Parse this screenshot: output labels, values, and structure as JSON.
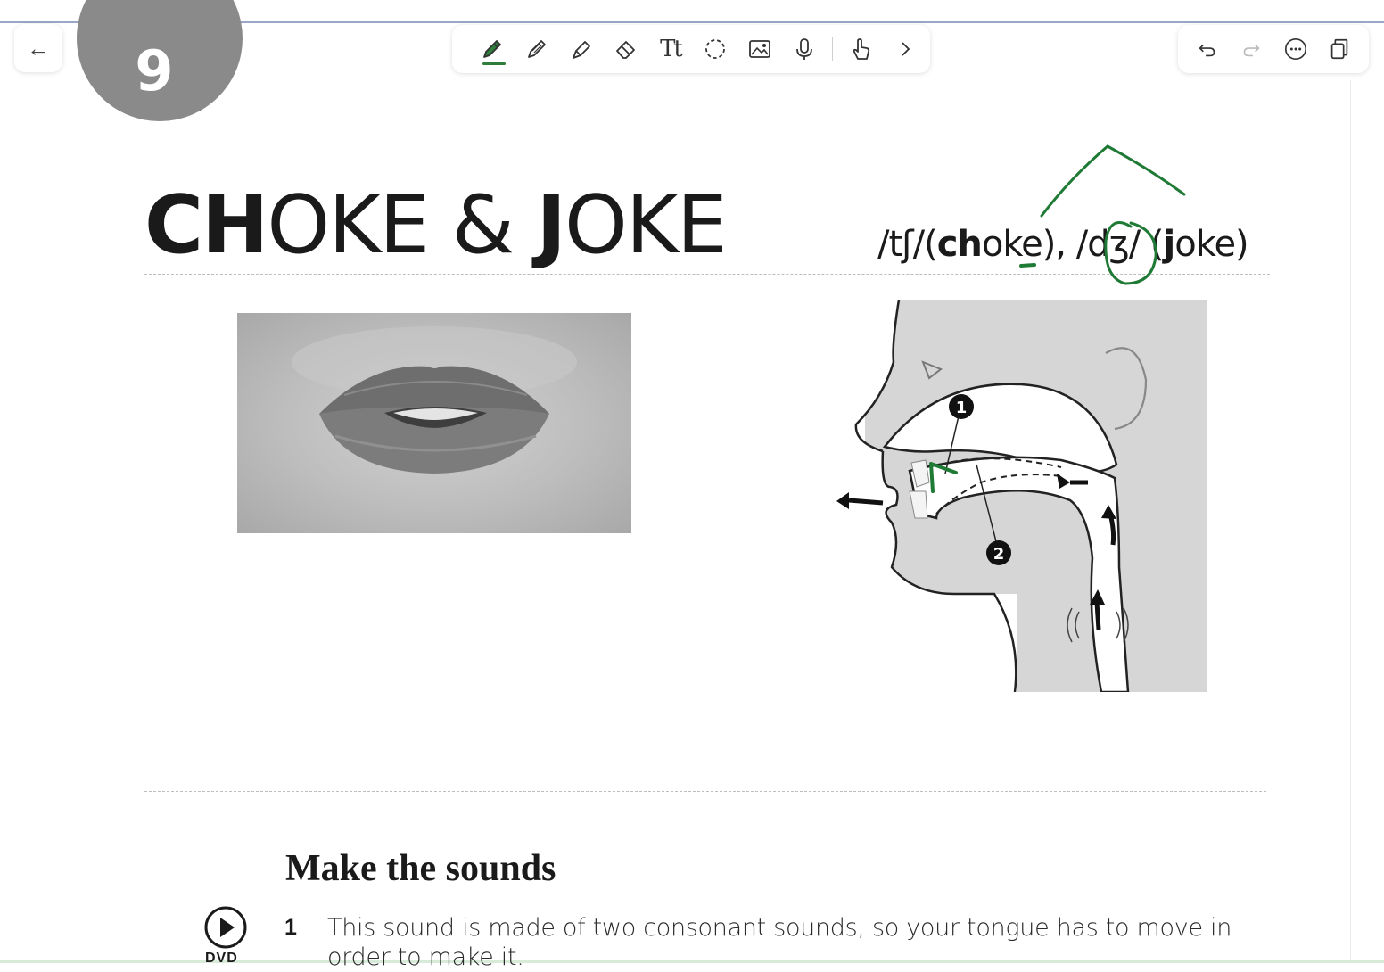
{
  "toolbar": {
    "tools": [
      "pen-icon",
      "pencil-icon",
      "highlighter-icon",
      "eraser-icon",
      "text-icon",
      "lasso-icon",
      "image-icon",
      "microphone-icon",
      "touch-icon",
      "chevron-right-icon"
    ],
    "text_tool_label": "Tt",
    "active_color": "#2e7d3a"
  },
  "top_right": {
    "icons": [
      "undo-icon",
      "redo-icon",
      "more-icon",
      "pages-icon"
    ]
  },
  "page": {
    "chapter_number": "9",
    "title_bold_1": "CH",
    "title_light_1": "OKE & ",
    "title_bold_2": "J",
    "title_light_2": "OKE",
    "ipa_1": "/tʃ/(",
    "ipa_1_bold": "ch",
    "ipa_1_rest": "oke), ",
    "ipa_2": "/dʒ/ (",
    "ipa_2_bold": "j",
    "ipa_2_rest": "oke)",
    "diagram_label_1": "1",
    "diagram_label_2": "2",
    "section_title": "Make the sounds",
    "dvd_label": "DVD",
    "step_number": "1",
    "step_text": "This sound is made of two consonant sounds, so your tongue has to move in order to make it."
  },
  "colors": {
    "chapter_circle": "#8a8a8a",
    "annotation_ink": "#1f7a35"
  }
}
